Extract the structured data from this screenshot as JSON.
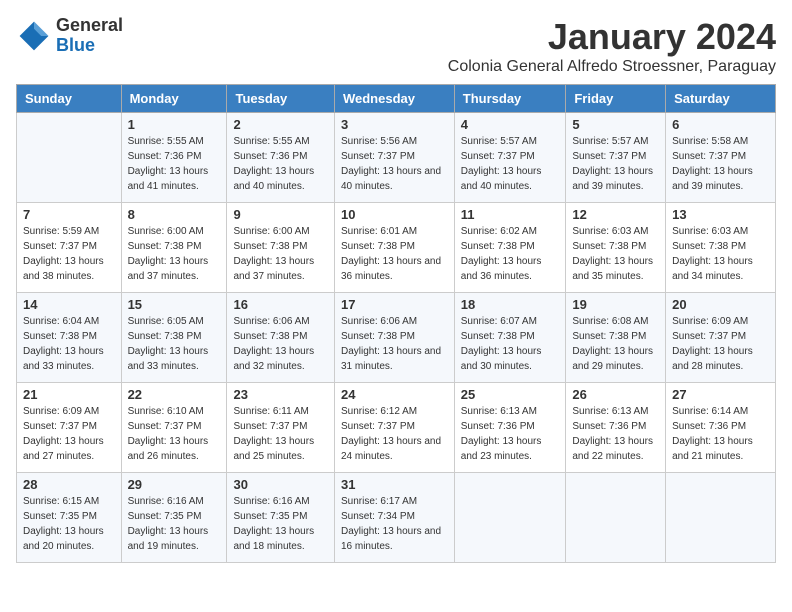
{
  "logo": {
    "general": "General",
    "blue": "Blue"
  },
  "title": "January 2024",
  "location": "Colonia General Alfredo Stroessner, Paraguay",
  "days_of_week": [
    "Sunday",
    "Monday",
    "Tuesday",
    "Wednesday",
    "Thursday",
    "Friday",
    "Saturday"
  ],
  "weeks": [
    [
      {
        "day": "",
        "sunrise": "",
        "sunset": "",
        "daylight": ""
      },
      {
        "day": "1",
        "sunrise": "Sunrise: 5:55 AM",
        "sunset": "Sunset: 7:36 PM",
        "daylight": "Daylight: 13 hours and 41 minutes."
      },
      {
        "day": "2",
        "sunrise": "Sunrise: 5:55 AM",
        "sunset": "Sunset: 7:36 PM",
        "daylight": "Daylight: 13 hours and 40 minutes."
      },
      {
        "day": "3",
        "sunrise": "Sunrise: 5:56 AM",
        "sunset": "Sunset: 7:37 PM",
        "daylight": "Daylight: 13 hours and 40 minutes."
      },
      {
        "day": "4",
        "sunrise": "Sunrise: 5:57 AM",
        "sunset": "Sunset: 7:37 PM",
        "daylight": "Daylight: 13 hours and 40 minutes."
      },
      {
        "day": "5",
        "sunrise": "Sunrise: 5:57 AM",
        "sunset": "Sunset: 7:37 PM",
        "daylight": "Daylight: 13 hours and 39 minutes."
      },
      {
        "day": "6",
        "sunrise": "Sunrise: 5:58 AM",
        "sunset": "Sunset: 7:37 PM",
        "daylight": "Daylight: 13 hours and 39 minutes."
      }
    ],
    [
      {
        "day": "7",
        "sunrise": "Sunrise: 5:59 AM",
        "sunset": "Sunset: 7:37 PM",
        "daylight": "Daylight: 13 hours and 38 minutes."
      },
      {
        "day": "8",
        "sunrise": "Sunrise: 6:00 AM",
        "sunset": "Sunset: 7:38 PM",
        "daylight": "Daylight: 13 hours and 37 minutes."
      },
      {
        "day": "9",
        "sunrise": "Sunrise: 6:00 AM",
        "sunset": "Sunset: 7:38 PM",
        "daylight": "Daylight: 13 hours and 37 minutes."
      },
      {
        "day": "10",
        "sunrise": "Sunrise: 6:01 AM",
        "sunset": "Sunset: 7:38 PM",
        "daylight": "Daylight: 13 hours and 36 minutes."
      },
      {
        "day": "11",
        "sunrise": "Sunrise: 6:02 AM",
        "sunset": "Sunset: 7:38 PM",
        "daylight": "Daylight: 13 hours and 36 minutes."
      },
      {
        "day": "12",
        "sunrise": "Sunrise: 6:03 AM",
        "sunset": "Sunset: 7:38 PM",
        "daylight": "Daylight: 13 hours and 35 minutes."
      },
      {
        "day": "13",
        "sunrise": "Sunrise: 6:03 AM",
        "sunset": "Sunset: 7:38 PM",
        "daylight": "Daylight: 13 hours and 34 minutes."
      }
    ],
    [
      {
        "day": "14",
        "sunrise": "Sunrise: 6:04 AM",
        "sunset": "Sunset: 7:38 PM",
        "daylight": "Daylight: 13 hours and 33 minutes."
      },
      {
        "day": "15",
        "sunrise": "Sunrise: 6:05 AM",
        "sunset": "Sunset: 7:38 PM",
        "daylight": "Daylight: 13 hours and 33 minutes."
      },
      {
        "day": "16",
        "sunrise": "Sunrise: 6:06 AM",
        "sunset": "Sunset: 7:38 PM",
        "daylight": "Daylight: 13 hours and 32 minutes."
      },
      {
        "day": "17",
        "sunrise": "Sunrise: 6:06 AM",
        "sunset": "Sunset: 7:38 PM",
        "daylight": "Daylight: 13 hours and 31 minutes."
      },
      {
        "day": "18",
        "sunrise": "Sunrise: 6:07 AM",
        "sunset": "Sunset: 7:38 PM",
        "daylight": "Daylight: 13 hours and 30 minutes."
      },
      {
        "day": "19",
        "sunrise": "Sunrise: 6:08 AM",
        "sunset": "Sunset: 7:38 PM",
        "daylight": "Daylight: 13 hours and 29 minutes."
      },
      {
        "day": "20",
        "sunrise": "Sunrise: 6:09 AM",
        "sunset": "Sunset: 7:37 PM",
        "daylight": "Daylight: 13 hours and 28 minutes."
      }
    ],
    [
      {
        "day": "21",
        "sunrise": "Sunrise: 6:09 AM",
        "sunset": "Sunset: 7:37 PM",
        "daylight": "Daylight: 13 hours and 27 minutes."
      },
      {
        "day": "22",
        "sunrise": "Sunrise: 6:10 AM",
        "sunset": "Sunset: 7:37 PM",
        "daylight": "Daylight: 13 hours and 26 minutes."
      },
      {
        "day": "23",
        "sunrise": "Sunrise: 6:11 AM",
        "sunset": "Sunset: 7:37 PM",
        "daylight": "Daylight: 13 hours and 25 minutes."
      },
      {
        "day": "24",
        "sunrise": "Sunrise: 6:12 AM",
        "sunset": "Sunset: 7:37 PM",
        "daylight": "Daylight: 13 hours and 24 minutes."
      },
      {
        "day": "25",
        "sunrise": "Sunrise: 6:13 AM",
        "sunset": "Sunset: 7:36 PM",
        "daylight": "Daylight: 13 hours and 23 minutes."
      },
      {
        "day": "26",
        "sunrise": "Sunrise: 6:13 AM",
        "sunset": "Sunset: 7:36 PM",
        "daylight": "Daylight: 13 hours and 22 minutes."
      },
      {
        "day": "27",
        "sunrise": "Sunrise: 6:14 AM",
        "sunset": "Sunset: 7:36 PM",
        "daylight": "Daylight: 13 hours and 21 minutes."
      }
    ],
    [
      {
        "day": "28",
        "sunrise": "Sunrise: 6:15 AM",
        "sunset": "Sunset: 7:35 PM",
        "daylight": "Daylight: 13 hours and 20 minutes."
      },
      {
        "day": "29",
        "sunrise": "Sunrise: 6:16 AM",
        "sunset": "Sunset: 7:35 PM",
        "daylight": "Daylight: 13 hours and 19 minutes."
      },
      {
        "day": "30",
        "sunrise": "Sunrise: 6:16 AM",
        "sunset": "Sunset: 7:35 PM",
        "daylight": "Daylight: 13 hours and 18 minutes."
      },
      {
        "day": "31",
        "sunrise": "Sunrise: 6:17 AM",
        "sunset": "Sunset: 7:34 PM",
        "daylight": "Daylight: 13 hours and 16 minutes."
      },
      {
        "day": "",
        "sunrise": "",
        "sunset": "",
        "daylight": ""
      },
      {
        "day": "",
        "sunrise": "",
        "sunset": "",
        "daylight": ""
      },
      {
        "day": "",
        "sunrise": "",
        "sunset": "",
        "daylight": ""
      }
    ]
  ]
}
